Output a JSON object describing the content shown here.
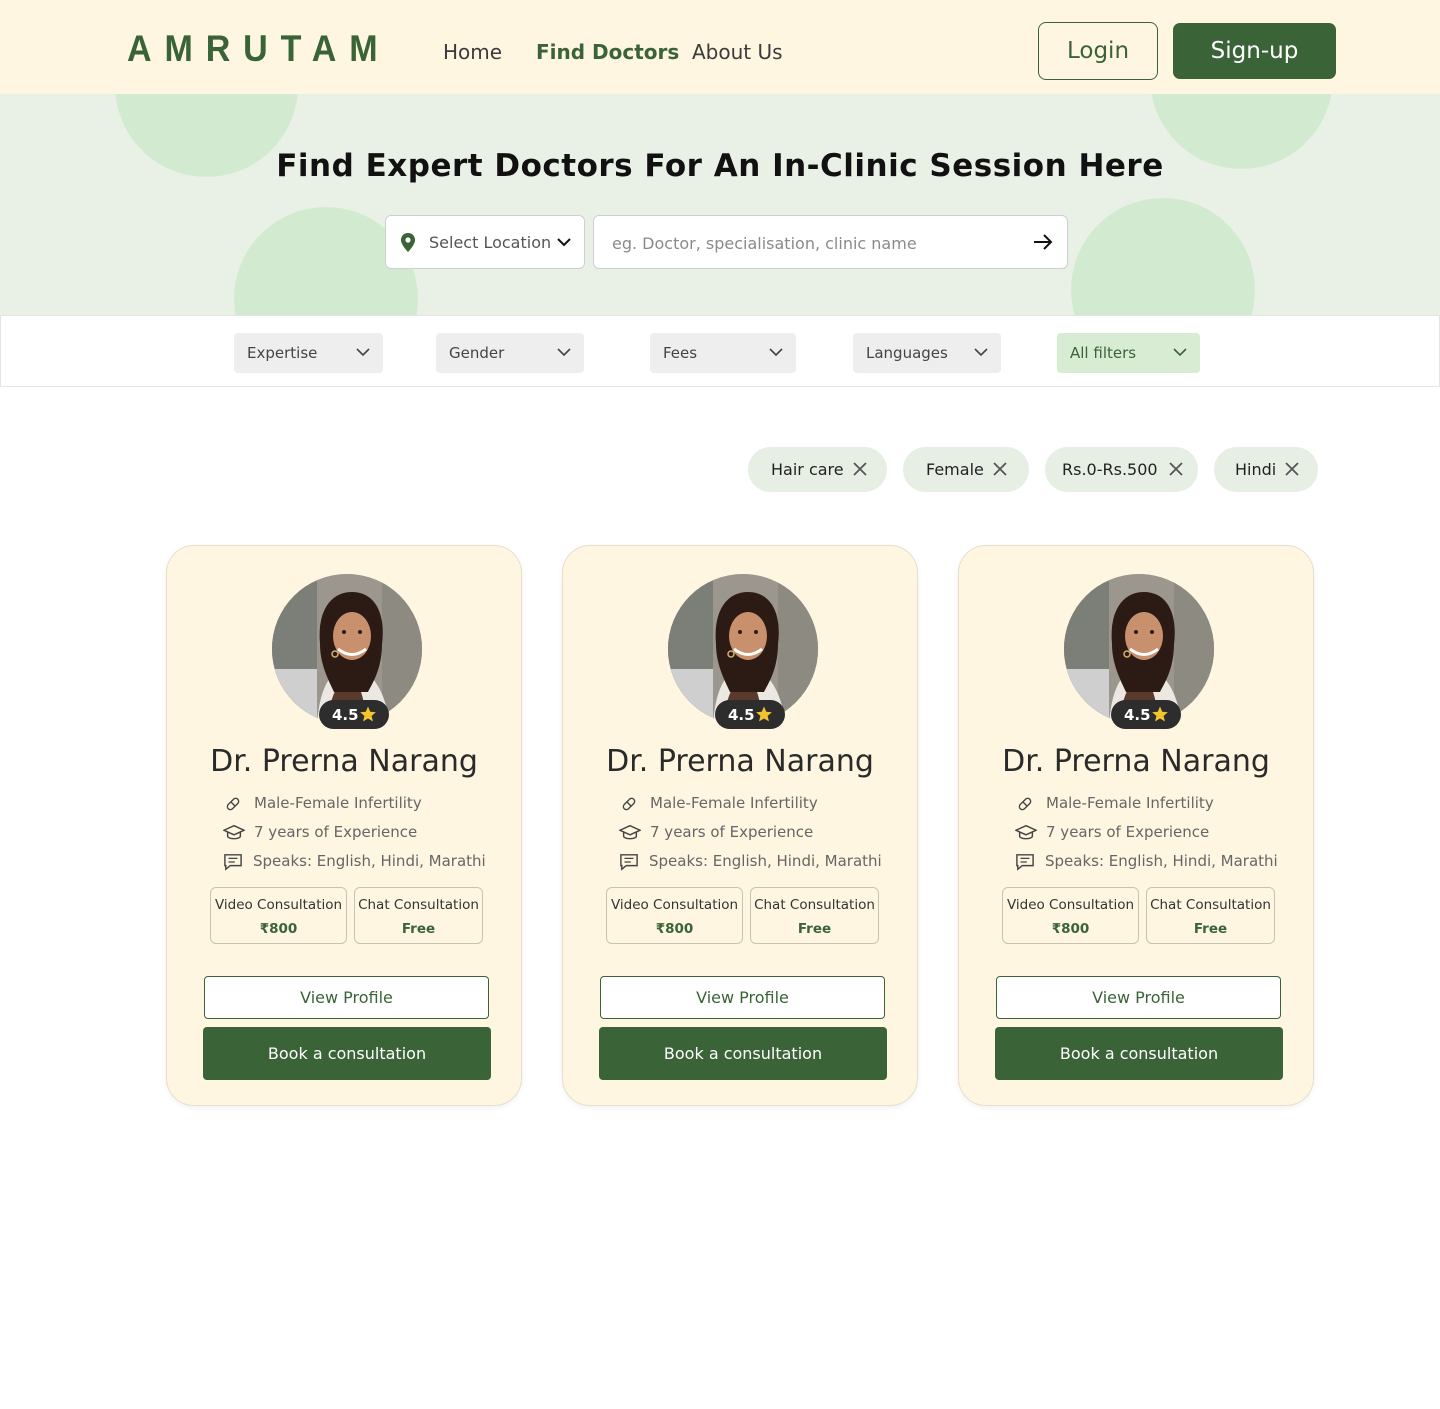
{
  "brand": {
    "logo": "AMRUTAM",
    "accent": "#3a6338",
    "cream": "#fef6e1"
  },
  "nav": {
    "items": [
      {
        "label": "Home",
        "active": false
      },
      {
        "label": "Find Doctors",
        "active": true
      },
      {
        "label": "About Us",
        "active": false
      }
    ]
  },
  "auth": {
    "login_label": "Login",
    "signup_label": "Sign-up"
  },
  "hero": {
    "title": "Find Expert Doctors For An In-Clinic Session Here",
    "location_label": "Select Location",
    "search_placeholder": "eg. Doctor, specialisation, clinic name"
  },
  "filters": [
    {
      "label": "Expertise"
    },
    {
      "label": "Gender"
    },
    {
      "label": "Fees"
    },
    {
      "label": "Languages"
    },
    {
      "label": "All filters"
    }
  ],
  "active_chips": [
    {
      "label": "Hair care"
    },
    {
      "label": "Female"
    },
    {
      "label": "Rs.0-Rs.500"
    },
    {
      "label": "Hindi"
    }
  ],
  "doctors": [
    {
      "rating": "4.5",
      "name": "Dr. Prerna Narang",
      "specialty": "Male-Female Infertility",
      "experience": "7 years of Experience",
      "languages": "Speaks: English, Hindi, Marathi",
      "video_label": "Video Consultation",
      "video_price": "₹800",
      "chat_label": "Chat Consultation",
      "chat_price": "Free",
      "view_label": "View Profile",
      "book_label": "Book a consultation"
    },
    {
      "rating": "4.5",
      "name": "Dr. Prerna Narang",
      "specialty": "Male-Female Infertility",
      "experience": "7 years of Experience",
      "languages": "Speaks: English, Hindi, Marathi",
      "video_label": "Video Consultation",
      "video_price": "₹800",
      "chat_label": "Chat Consultation",
      "chat_price": "Free",
      "view_label": "View Profile",
      "book_label": "Book a consultation"
    },
    {
      "rating": "4.5",
      "name": "Dr. Prerna Narang",
      "specialty": "Male-Female Infertility",
      "experience": "7 years of Experience",
      "languages": "Speaks: English, Hindi, Marathi",
      "video_label": "Video Consultation",
      "video_price": "₹800",
      "chat_label": "Chat Consultation",
      "chat_price": "Free",
      "view_label": "View Profile",
      "book_label": "Book a consultation"
    }
  ]
}
